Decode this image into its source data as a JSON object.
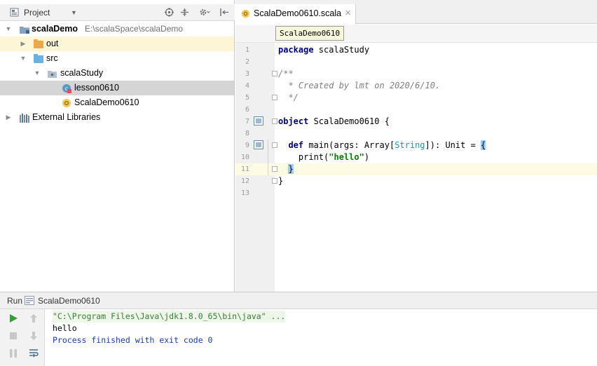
{
  "project_panel": {
    "title": "Project",
    "tree": [
      {
        "label": "scalaDemo",
        "path": "E:\\scalaSpace\\scalaDemo",
        "icon": "module-folder-icon"
      },
      {
        "label": "out",
        "icon": "folder-orange-icon"
      },
      {
        "label": "src",
        "icon": "folder-blue-icon"
      },
      {
        "label": "scalaStudy",
        "icon": "package-icon"
      },
      {
        "label": "lesson0610",
        "icon": "scala-class-icon"
      },
      {
        "label": "ScalaDemo0610",
        "icon": "scala-object-icon"
      },
      {
        "label": "External Libraries",
        "icon": "libraries-icon"
      }
    ]
  },
  "editor": {
    "tab_label": "ScalaDemo0610.scala",
    "tooltip": "ScalaDemo0610",
    "lines": [
      {
        "n": "1",
        "parts": [
          {
            "t": "package",
            "c": "kw"
          },
          {
            "t": " scalaStudy",
            "c": ""
          }
        ]
      },
      {
        "n": "2",
        "parts": []
      },
      {
        "n": "3",
        "parts": [
          {
            "t": "/**",
            "c": "cm"
          }
        ]
      },
      {
        "n": "4",
        "parts": [
          {
            "t": "  * Created by lmt on 2020/6/10.",
            "c": "cm"
          }
        ]
      },
      {
        "n": "5",
        "parts": [
          {
            "t": "  */",
            "c": "cm"
          }
        ]
      },
      {
        "n": "6",
        "parts": []
      },
      {
        "n": "7",
        "parts": [
          {
            "t": "object",
            "c": "kw"
          },
          {
            "t": " ScalaDemo0610 {",
            "c": ""
          }
        ]
      },
      {
        "n": "8",
        "parts": []
      },
      {
        "n": "9",
        "parts": [
          {
            "t": "  ",
            "c": ""
          },
          {
            "t": "def",
            "c": "kw"
          },
          {
            "t": " main(args: Array[",
            "c": ""
          },
          {
            "t": "String",
            "c": "tp"
          },
          {
            "t": "]): Unit = ",
            "c": ""
          },
          {
            "t": "{",
            "c": "brace-hl"
          }
        ]
      },
      {
        "n": "10",
        "parts": [
          {
            "t": "    print(",
            "c": ""
          },
          {
            "t": "\"hello\"",
            "c": "str"
          },
          {
            "t": ")",
            "c": ""
          }
        ]
      },
      {
        "n": "11",
        "parts": [
          {
            "t": "  ",
            "c": ""
          },
          {
            "t": "}",
            "c": "brace-hl"
          }
        ]
      },
      {
        "n": "12",
        "parts": [
          {
            "t": "}",
            "c": ""
          }
        ]
      },
      {
        "n": "13",
        "parts": []
      }
    ],
    "current_line": "11"
  },
  "run_panel": {
    "label": "Run",
    "config_name": "ScalaDemo0610",
    "console": [
      {
        "text": "\"C:\\Program Files\\Java\\jdk1.8.0_65\\bin\\java\" ...",
        "style": "cmd"
      },
      {
        "text": "hello",
        "style": "out"
      },
      {
        "text": "Process finished with exit code 0",
        "style": "sys"
      }
    ]
  },
  "colors": {
    "accent_green": "#3b9b3b",
    "folder_orange": "#f0a64a",
    "folder_blue": "#6cb0e0",
    "keyword": "#000080",
    "comment": "#808080",
    "string": "#008000"
  }
}
